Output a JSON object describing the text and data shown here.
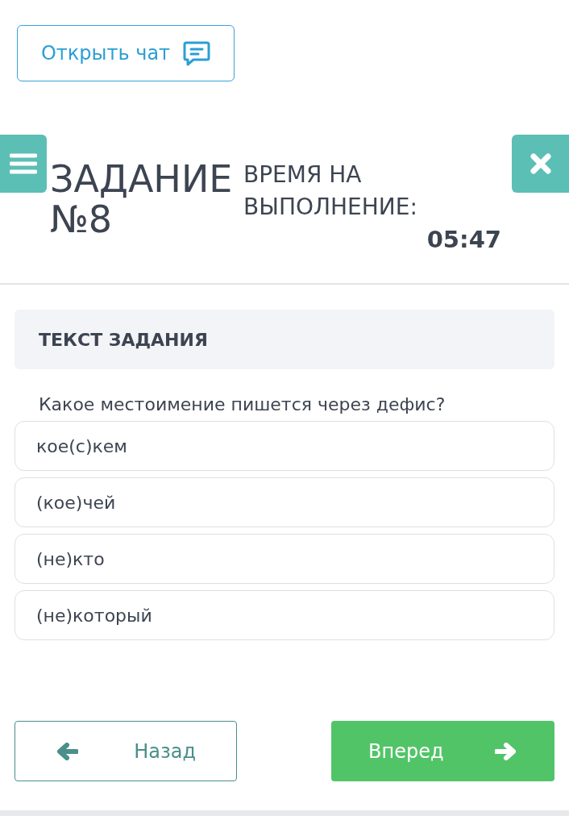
{
  "chat_button": {
    "label": "Открыть чат"
  },
  "task": {
    "title_line_1": "ЗАДАНИЕ",
    "title_line_2": "№8",
    "time_label": "ВРЕМЯ НА ВЫПОЛНЕНИЕ:",
    "time_value": "05:47"
  },
  "section": {
    "heading": "ТЕКСТ ЗАДАНИЯ"
  },
  "question": "Какое местоимение пишется через дефис?",
  "options": [
    {
      "label": "кое(с)кем",
      "selected": false
    },
    {
      "label": "(кое)чей",
      "selected": false
    },
    {
      "label": "(не)кто",
      "selected": false
    },
    {
      "label": "(не)который",
      "selected": false
    }
  ],
  "nav": {
    "back": "Назад",
    "next": "Вперед"
  }
}
